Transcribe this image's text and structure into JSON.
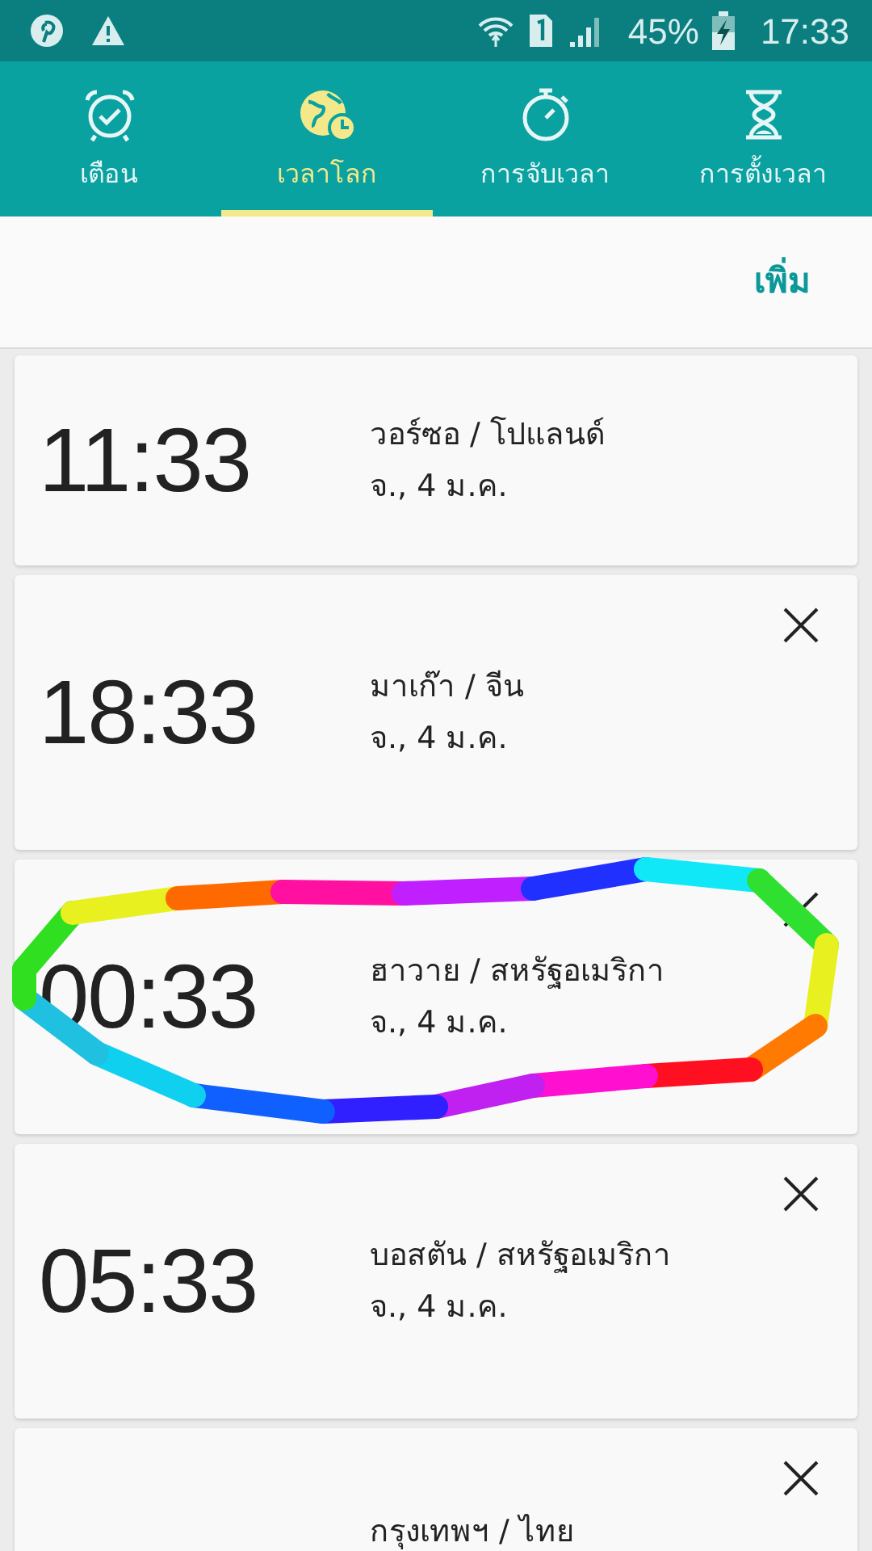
{
  "status_bar": {
    "battery": "45%",
    "time": "17:33"
  },
  "tabs": [
    {
      "label": "เตือน",
      "kind": "alarm",
      "selected": false
    },
    {
      "label": "เวลาโลก",
      "kind": "world",
      "selected": true
    },
    {
      "label": "การจับเวลา",
      "kind": "stopwatch",
      "selected": false
    },
    {
      "label": "การตั้งเวลา",
      "kind": "timer",
      "selected": false
    }
  ],
  "action": "เพิ่ม",
  "clocks": [
    {
      "time": "11:33",
      "city": "วอร์ซอ / โปแลนด์",
      "date": "จ., 4 ม.ค.",
      "close_visible": false
    },
    {
      "time": "18:33",
      "city": "มาเก๊า / จีน",
      "date": "จ., 4 ม.ค.",
      "close_visible": true
    },
    {
      "time": "00:33",
      "city": "ฮาวาย / สหรัฐอเมริกา",
      "date": "จ., 4 ม.ค.",
      "close_visible": true
    },
    {
      "time": "05:33",
      "city": "บอสตัน / สหรัฐอเมริกา",
      "date": "จ., 4 ม.ค.",
      "close_visible": true
    },
    {
      "city": "กรุงเทพฯ / ไทย",
      "close_visible": true
    }
  ],
  "annotation": {
    "kind": "freehand-loop"
  }
}
